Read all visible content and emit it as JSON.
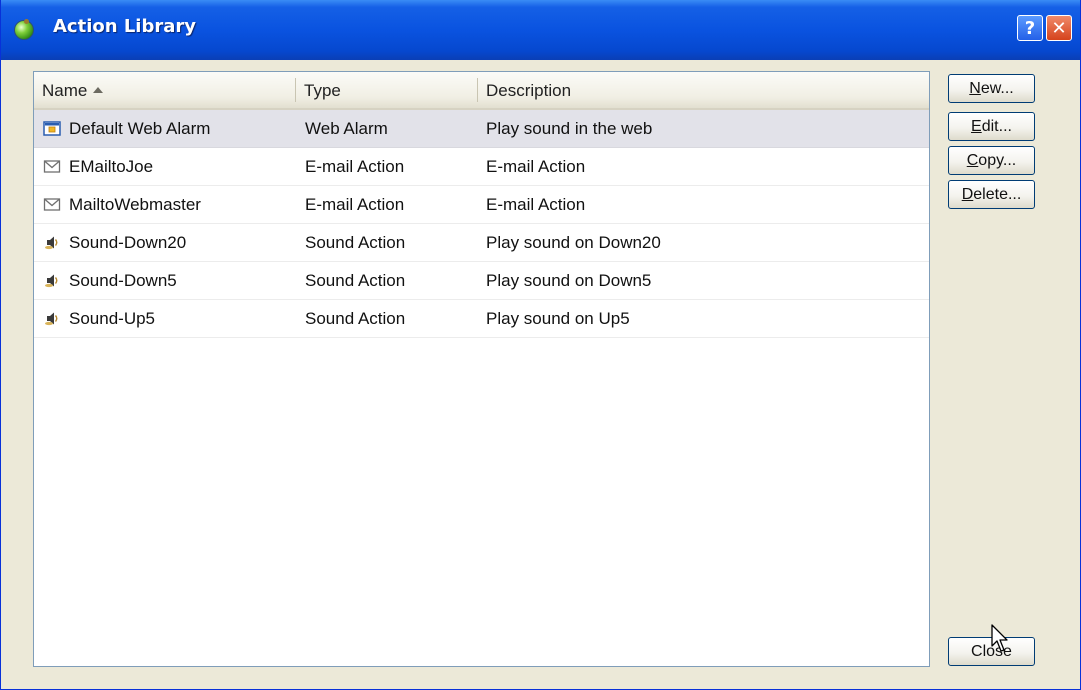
{
  "window": {
    "title": "Action Library"
  },
  "titlebar": {
    "help_glyph": "?",
    "close_glyph": "✕"
  },
  "list": {
    "columns": [
      {
        "label": "Name",
        "sorted": "ascending"
      },
      {
        "label": "Type"
      },
      {
        "label": "Description"
      }
    ],
    "rows": [
      {
        "icon": "web-alarm-icon",
        "name": "Default Web Alarm",
        "type": "Web Alarm",
        "description": "Play sound in the web",
        "selected": true
      },
      {
        "icon": "email-icon",
        "name": "EMailtoJoe",
        "type": "E-mail Action",
        "description": "E-mail Action"
      },
      {
        "icon": "email-icon",
        "name": "MailtoWebmaster",
        "type": "E-mail Action",
        "description": "E-mail Action"
      },
      {
        "icon": "sound-icon",
        "name": "Sound-Down20",
        "type": "Sound Action",
        "description": "Play sound on Down20"
      },
      {
        "icon": "sound-icon",
        "name": "Sound-Down5",
        "type": "Sound Action",
        "description": "Play sound on Down5"
      },
      {
        "icon": "sound-icon",
        "name": "Sound-Up5",
        "type": "Sound Action",
        "description": "Play sound on Up5"
      }
    ]
  },
  "buttons": {
    "new": {
      "mnemonic": "N",
      "rest": "ew..."
    },
    "edit": {
      "mnemonic": "E",
      "rest": "dit..."
    },
    "copy": {
      "mnemonic": "C",
      "rest": "opy..."
    },
    "delete": {
      "mnemonic": "D",
      "rest": "elete..."
    },
    "close": {
      "label": "Close"
    }
  },
  "colors": {
    "titlebar": "#0a53e0",
    "dialog": "#ece9d8",
    "selected_row": "#e2e2e9",
    "button_border": "#003c74"
  }
}
